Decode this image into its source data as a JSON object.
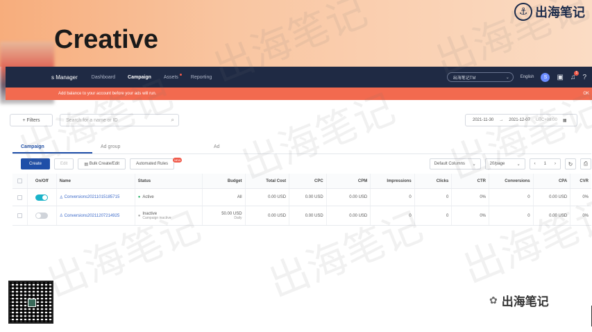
{
  "slide": {
    "title": "Creative",
    "brand": "出海笔记",
    "brand_icon": "anchor-icon"
  },
  "nav": {
    "brand": "s Manager",
    "items": [
      {
        "label": "Dashboard"
      },
      {
        "label": "Campaign",
        "active": true
      },
      {
        "label": "Assets"
      },
      {
        "label": "Reporting"
      }
    ],
    "account_select": "出海笔记TM",
    "language": "English",
    "avatar_letter": "S",
    "notifications_count": "1"
  },
  "alert": {
    "message": "Add balance to your account before your ads will run.",
    "right": "OK"
  },
  "filters": {
    "label": "Filters",
    "search_placeholder": "Search for a name or ID",
    "date_start": "2021-11-30",
    "date_end": "2021-12-07",
    "timezone": "UTC+08:00"
  },
  "tabs": [
    {
      "label": "Campaign",
      "active": true
    },
    {
      "label": "Ad group"
    },
    {
      "label": "Ad"
    }
  ],
  "toolbar": {
    "create": "Create",
    "edit": "Edit",
    "bulk": "Bulk Create/Edit",
    "rules": "Automated Rules",
    "new_badge": "NEW",
    "columns": "Default Columns",
    "per_page": "20/page",
    "page": "1"
  },
  "table": {
    "headers": [
      "On/Off",
      "Name",
      "Status",
      "Budget",
      "Total Cost",
      "CPC",
      "CPM",
      "Impressions",
      "Clicks",
      "CTR",
      "Conversions",
      "CPA",
      "CVR"
    ],
    "rows": [
      {
        "on": true,
        "name": "Conversions20211015185715",
        "status": "Active",
        "status_sub": "",
        "budget": "All",
        "budget_sub": "",
        "total_cost": "0.00 USD",
        "cpc": "0.00 USD",
        "cpm": "0.00 USD",
        "impressions": "0",
        "clicks": "0",
        "ctr": "0%",
        "conversions": "0",
        "cpa": "0.00 USD",
        "cvr": "0%"
      },
      {
        "on": false,
        "name": "Conversions20211207214925",
        "status": "Inactive",
        "status_sub": "Campaign inactive",
        "budget": "50.00 USD",
        "budget_sub": "Daily",
        "total_cost": "0.00 USD",
        "cpc": "0.00 USD",
        "cpm": "0.00 USD",
        "impressions": "0",
        "clicks": "0",
        "ctr": "0%",
        "conversions": "0",
        "cpa": "0.00 USD",
        "cvr": "0%"
      }
    ]
  },
  "footer": {
    "wechat_label": "出海笔记",
    "watermark": "出海笔记"
  }
}
